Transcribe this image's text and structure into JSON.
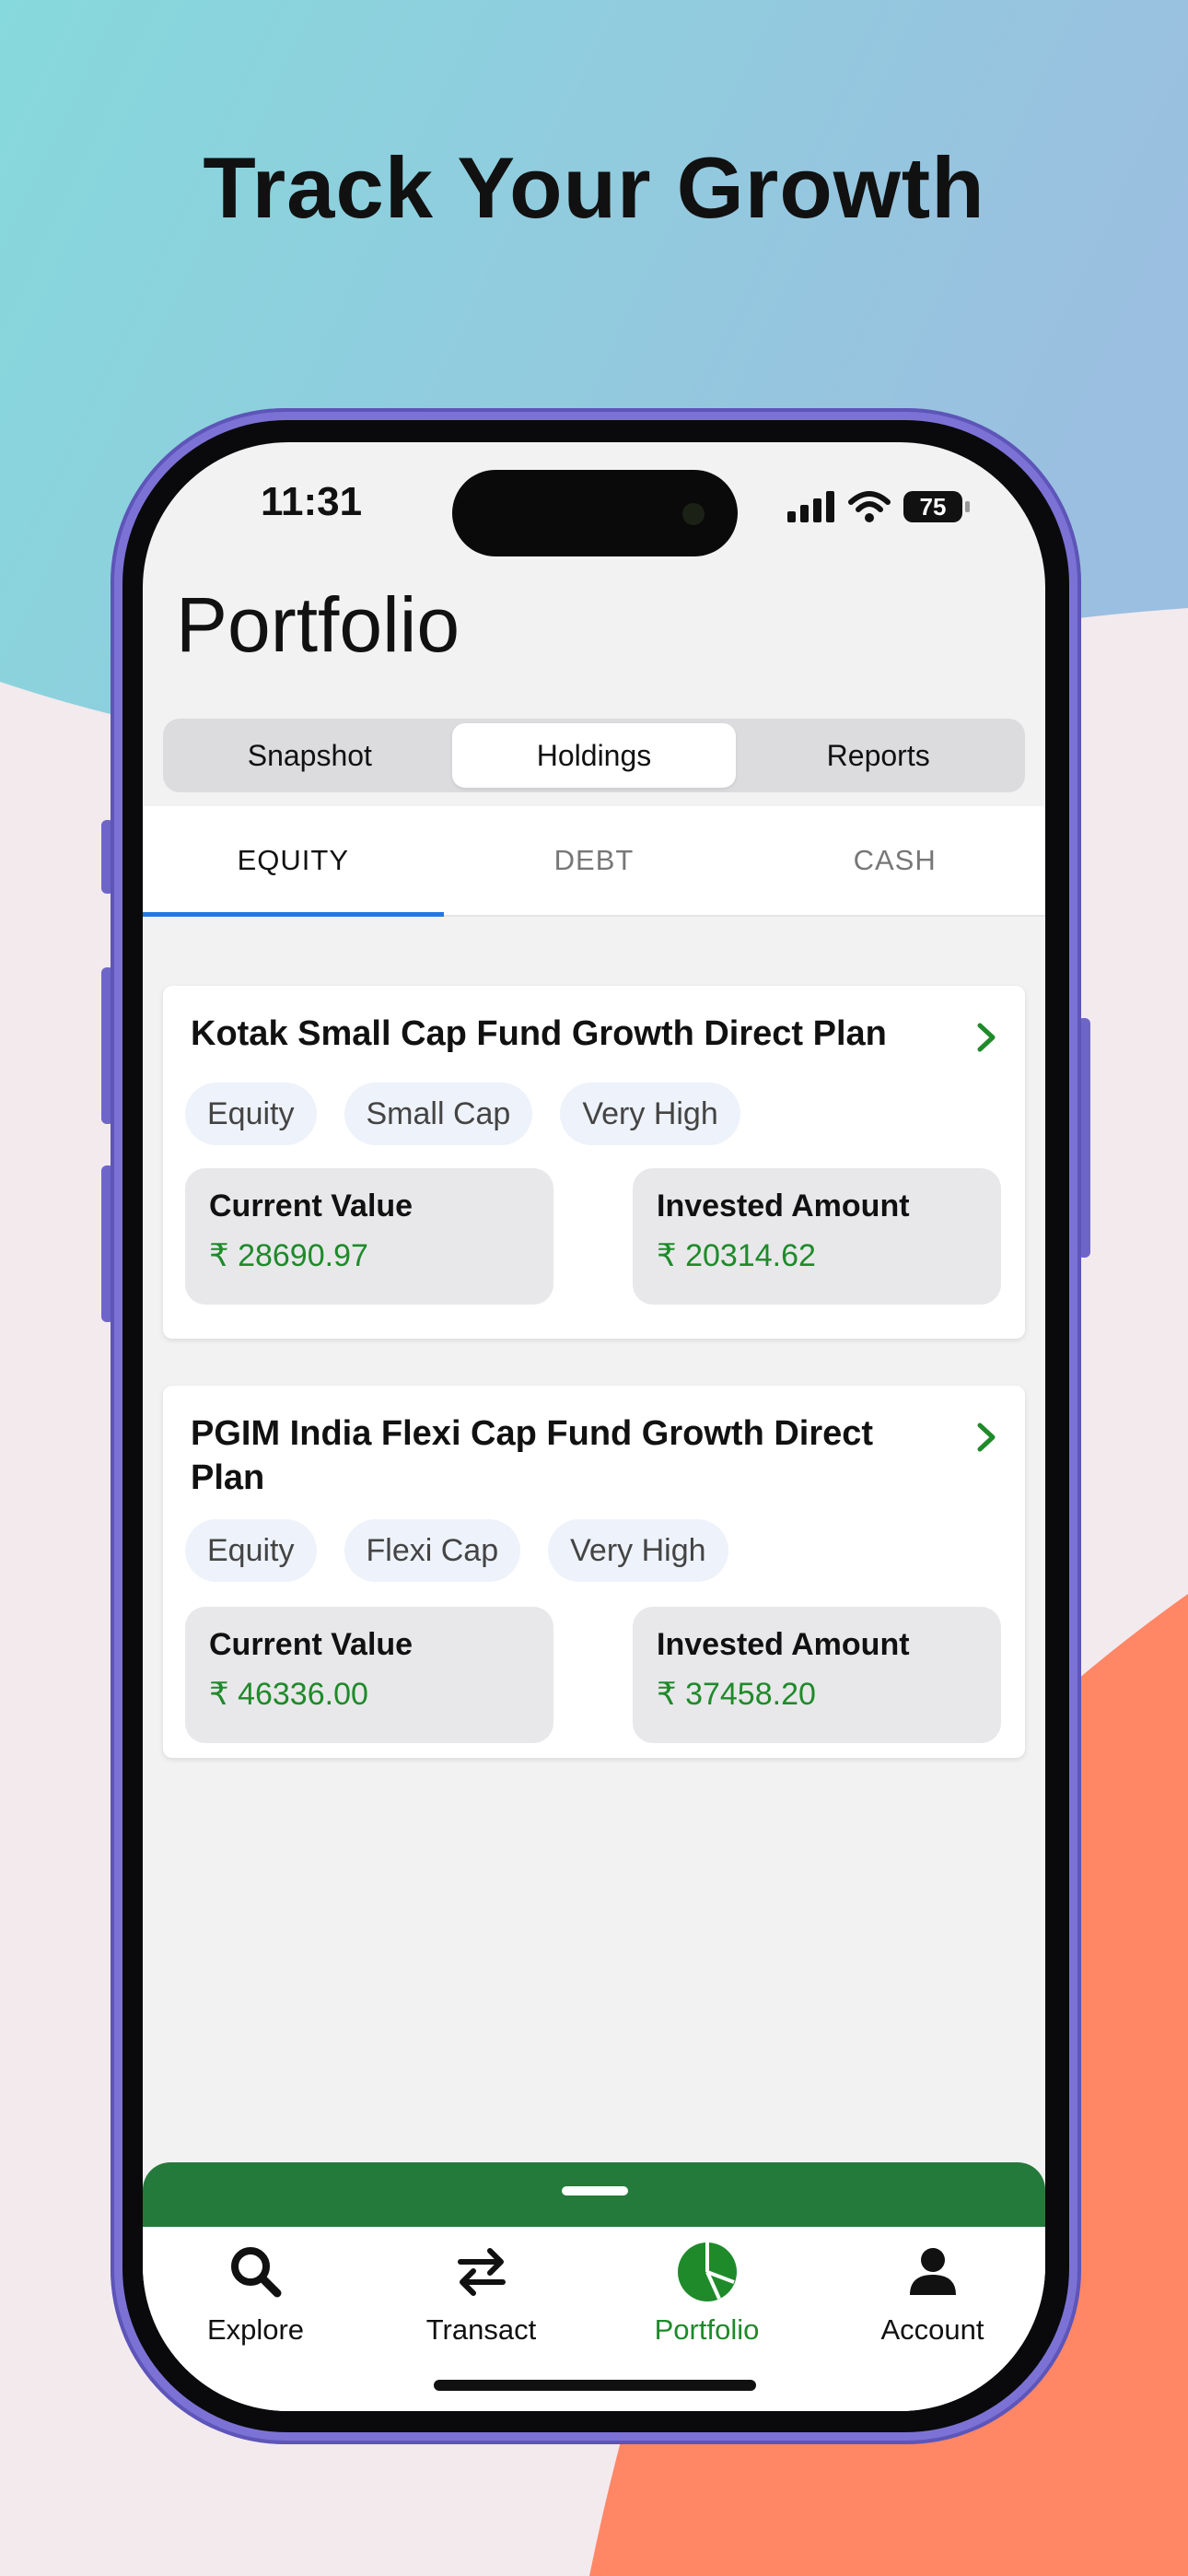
{
  "headline": "Track Your Growth",
  "status_bar": {
    "time": "11:31",
    "battery": "75"
  },
  "page": {
    "title": "Portfolio"
  },
  "segments": [
    {
      "label": "Snapshot",
      "active": false
    },
    {
      "label": "Holdings",
      "active": true
    },
    {
      "label": "Reports",
      "active": false
    }
  ],
  "subtabs": [
    {
      "label": "EQUITY",
      "active": true
    },
    {
      "label": "DEBT",
      "active": false
    },
    {
      "label": "CASH",
      "active": false
    }
  ],
  "holdings": [
    {
      "title": "Kotak Small Cap Fund  Growth  Direct Plan",
      "tags": [
        "Equity",
        "Small Cap",
        "Very High"
      ],
      "current_value_label": "Current Value",
      "current_value": "₹ 28690.97",
      "invested_label": "Invested Amount",
      "invested_value": "₹ 20314.62"
    },
    {
      "title": "PGIM India Flexi Cap Fund  Growth  Direct Plan",
      "tags": [
        "Equity",
        "Flexi Cap",
        "Very High"
      ],
      "current_value_label": "Current Value",
      "current_value": "₹ 46336.00",
      "invested_label": "Invested Amount",
      "invested_value": "₹ 37458.20"
    }
  ],
  "tabbar": [
    {
      "label": "Explore",
      "icon": "search-icon",
      "active": false
    },
    {
      "label": "Transact",
      "icon": "arrows-swap-icon",
      "active": false
    },
    {
      "label": "Portfolio",
      "icon": "pie-chart-icon",
      "active": true
    },
    {
      "label": "Account",
      "icon": "person-icon",
      "active": false
    }
  ],
  "colors": {
    "accent_green": "#1f8a2a",
    "tab_underline": "#1f7ae0",
    "sheet_green": "#247a3a"
  }
}
